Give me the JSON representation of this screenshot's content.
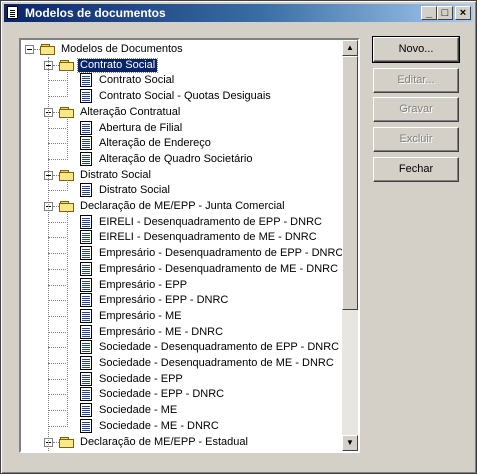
{
  "window": {
    "title": "Modelos de documentos"
  },
  "titlebar_buttons": [
    "_",
    "□",
    "×"
  ],
  "tree": {
    "nodes": [
      {
        "label": "Modelos de Documentos",
        "icon": "folder-icon",
        "level": 0,
        "expanded": true
      },
      {
        "label": "Contrato Social",
        "icon": "folder-icon",
        "level": 1,
        "expanded": true,
        "selected": true
      },
      {
        "label": "Contrato Social",
        "icon": "document-icon",
        "level": 2
      },
      {
        "label": "Contrato Social - Quotas Desiguais",
        "icon": "document-icon",
        "level": 2
      },
      {
        "label": "Alteração Contratual",
        "icon": "folder-icon",
        "level": 1,
        "expanded": true
      },
      {
        "label": "Abertura de Filial",
        "icon": "document-icon",
        "level": 2
      },
      {
        "label": "Alteração de Endereço",
        "icon": "document-icon",
        "level": 2
      },
      {
        "label": "Alteração de Quadro Societário",
        "icon": "document-icon",
        "level": 2
      },
      {
        "label": "Distrato Social",
        "icon": "folder-icon",
        "level": 1,
        "expanded": true
      },
      {
        "label": "Distrato Social",
        "icon": "document-icon",
        "level": 2
      },
      {
        "label": "Declaração de ME/EPP - Junta Comercial",
        "icon": "folder-icon",
        "level": 1,
        "expanded": true
      },
      {
        "label": "EIRELI - Desenquadramento de EPP - DNRC",
        "icon": "document-icon",
        "level": 2
      },
      {
        "label": "EIRELI - Desenquadramento de ME - DNRC",
        "icon": "document-icon",
        "level": 2
      },
      {
        "label": "Empresário - Desenquadramento de EPP - DNRC",
        "icon": "document-icon",
        "level": 2
      },
      {
        "label": "Empresário - Desenquadramento de ME - DNRC",
        "icon": "document-icon",
        "level": 2
      },
      {
        "label": "Empresário - EPP",
        "icon": "document-icon",
        "level": 2
      },
      {
        "label": "Empresário - EPP - DNRC",
        "icon": "document-icon",
        "level": 2
      },
      {
        "label": "Empresário - ME",
        "icon": "document-icon",
        "level": 2
      },
      {
        "label": "Empresário - ME - DNRC",
        "icon": "document-icon",
        "level": 2
      },
      {
        "label": "Sociedade - Desenquadramento de EPP - DNRC",
        "icon": "document-icon",
        "level": 2
      },
      {
        "label": "Sociedade - Desenquadramento de ME - DNRC",
        "icon": "document-icon",
        "level": 2
      },
      {
        "label": "Sociedade - EPP",
        "icon": "document-icon",
        "level": 2
      },
      {
        "label": "Sociedade - EPP - DNRC",
        "icon": "document-icon",
        "level": 2
      },
      {
        "label": "Sociedade - ME",
        "icon": "document-icon",
        "level": 2
      },
      {
        "label": "Sociedade - ME - DNRC",
        "icon": "document-icon",
        "level": 2
      },
      {
        "label": "Declaração de ME/EPP - Estadual",
        "icon": "folder-icon",
        "level": 1,
        "expanded": true
      }
    ]
  },
  "buttons": {
    "novo": "Novo...",
    "editar": "Editar...",
    "gravar": "Gravar",
    "excluir": "Excluir",
    "fechar": "Fechar"
  },
  "colors": {
    "titlebar_start": "#0a246a",
    "selection": "#0a246a",
    "face": "#d4d0c8"
  }
}
